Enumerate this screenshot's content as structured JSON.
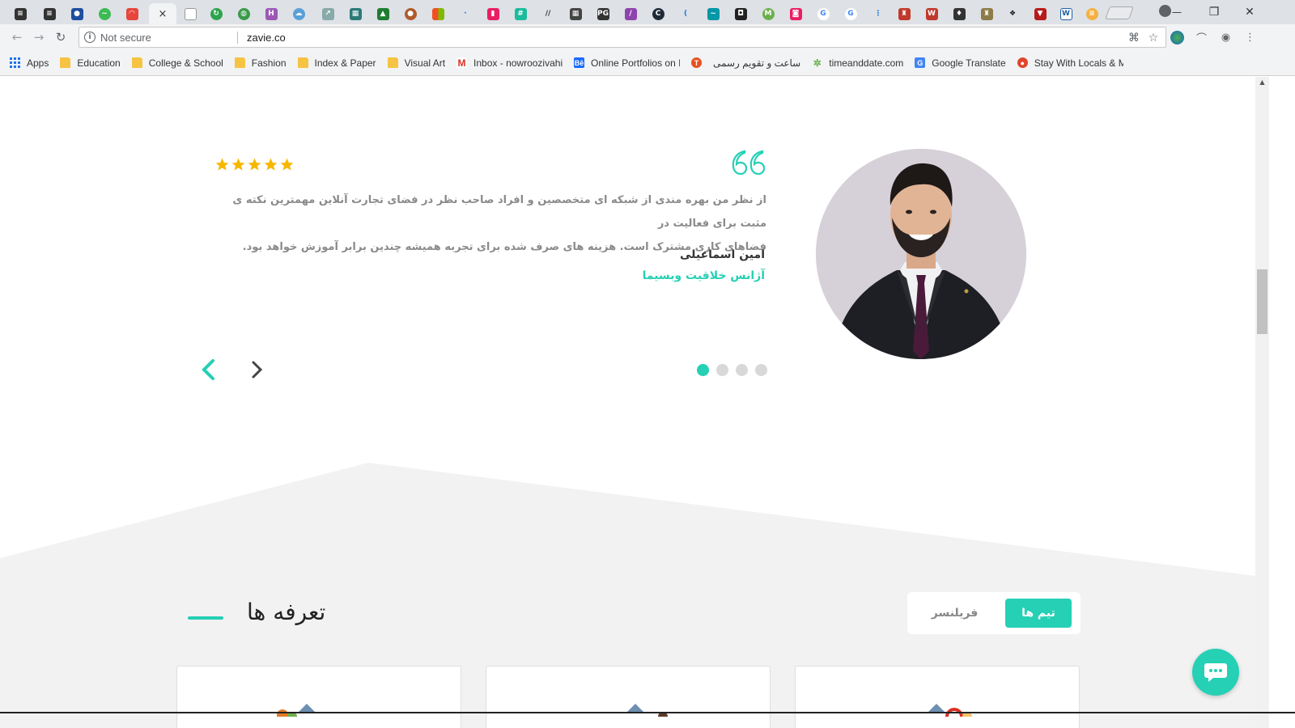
{
  "browser": {
    "active_tab_close": "×",
    "address": {
      "security_label": "Not secure",
      "url": "zavie.co"
    },
    "window_controls": {
      "minimize": "—",
      "maximize": "❐",
      "close": "✕"
    },
    "bookmarks": [
      {
        "label": "Apps",
        "icon": "apps-grid-icon"
      },
      {
        "label": "Education",
        "icon": "folder-icon"
      },
      {
        "label": "College & School",
        "icon": "folder-icon"
      },
      {
        "label": "Fashion",
        "icon": "folder-icon"
      },
      {
        "label": "Index & Paper",
        "icon": "folder-icon"
      },
      {
        "label": "Visual Art",
        "icon": "folder-icon"
      },
      {
        "label": "Inbox - nowroozivahi",
        "icon": "gmail-icon"
      },
      {
        "label": "Online Portfolios on I",
        "icon": "behance-icon"
      },
      {
        "label": "",
        "icon": "orange-t-icon"
      },
      {
        "label": "ساعت و تقویم رسمی",
        "icon": ""
      },
      {
        "label": "timeanddate.com",
        "icon": "timeanddate-icon"
      },
      {
        "label": "Google Translate",
        "icon": "google-translate-icon"
      },
      {
        "label": "Stay With Locals & M",
        "icon": "couchsurfing-icon"
      }
    ]
  },
  "testimonial": {
    "rating": 5,
    "text_line1": "از نظر من بهره مندی از شبکه ای متخصصین و افراد صاحب نظر در فضای تجارت آنلاین مهمترین نکته ی مثبت برای فعالیت در",
    "text_line2": "فضاهای کاری مشترک است. هزینه های صرف شده برای تجربه همیشه چندین برابر آموزش خواهد بود.",
    "author_name": "امین اسماعیلی",
    "author_company": "آژانس خلاقیت وبسیما",
    "slide_count": 4,
    "active_slide": 1
  },
  "pricing": {
    "title": "تعرفه ها",
    "tabs": {
      "teams": "تیم ها",
      "freelancer": "فریلنسر"
    },
    "active_tab": "teams"
  },
  "colors": {
    "accent": "#25d0b5",
    "star": "#f5b800",
    "section_grey": "#f2f2f2"
  }
}
